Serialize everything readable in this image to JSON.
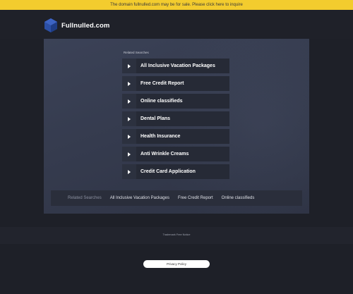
{
  "topbar": {
    "text": "The domain fullnulled.com may be for sale. Please click here to inquire"
  },
  "header": {
    "logo_text": "Fullnulled.com",
    "logo_color": "#2c50a6"
  },
  "related": {
    "title": "Related Searches",
    "links": [
      {
        "label": "All Inclusive Vacation Packages"
      },
      {
        "label": "Free Credit Report"
      },
      {
        "label": "Online classifieds"
      },
      {
        "label": "Dental Plans"
      },
      {
        "label": "Health Insurance"
      },
      {
        "label": "Anti Wrinkle Creams"
      },
      {
        "label": "Credit Card Application"
      }
    ]
  },
  "strip": {
    "heading": "Related Searches",
    "items": [
      {
        "label": "All Inclusive Vacation Packages"
      },
      {
        "label": "Free Credit Report"
      },
      {
        "label": "Online classifieds"
      }
    ]
  },
  "footer": {
    "notice": "Trademark Free Notice",
    "privacy_label": "Privacy Policy"
  },
  "colors": {
    "topbar": "#f3cc2e",
    "background": "#1e2028",
    "panel": "#383e52"
  }
}
